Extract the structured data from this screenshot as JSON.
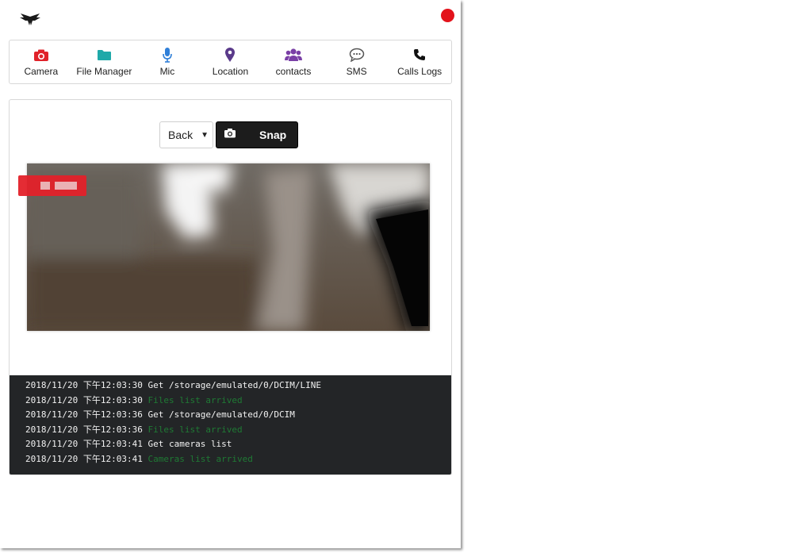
{
  "nav": {
    "items": [
      {
        "label": "Camera",
        "icon": "camera-icon",
        "color": "#e0222a"
      },
      {
        "label": "File Manager",
        "icon": "folder-icon",
        "color": "#1fa9a9"
      },
      {
        "label": "Mic",
        "icon": "microphone-icon",
        "color": "#2f7fd8"
      },
      {
        "label": "Location",
        "icon": "map-pin-icon",
        "color": "#5a3a8a"
      },
      {
        "label": "contacts",
        "icon": "users-icon",
        "color": "#7a3fa6"
      },
      {
        "label": "SMS",
        "icon": "chat-bubble-icon",
        "color": "#555555"
      },
      {
        "label": "Calls Logs",
        "icon": "phone-icon",
        "color": "#111111"
      }
    ]
  },
  "camera": {
    "select_value": "Back",
    "snap_label": "Snap"
  },
  "console": {
    "lines": [
      {
        "ts": "2018/11/20 下午12:03:30",
        "msg": "Get /storage/emulated/0/DCIM/LINE",
        "status": "info"
      },
      {
        "ts": "2018/11/20 下午12:03:30",
        "msg": "Files list arrived",
        "status": "success"
      },
      {
        "ts": "2018/11/20 下午12:03:36",
        "msg": "Get /storage/emulated/0/DCIM",
        "status": "info"
      },
      {
        "ts": "2018/11/20 下午12:03:36",
        "msg": "Files list arrived",
        "status": "success"
      },
      {
        "ts": "2018/11/20 下午12:03:41",
        "msg": "Get cameras list",
        "status": "info"
      },
      {
        "ts": "2018/11/20 下午12:03:41",
        "msg": "Cameras list arrived",
        "status": "success"
      }
    ]
  },
  "colors": {
    "close_dot": "#e3131b",
    "console_bg": "#232527",
    "success_text": "#1f7a34"
  }
}
